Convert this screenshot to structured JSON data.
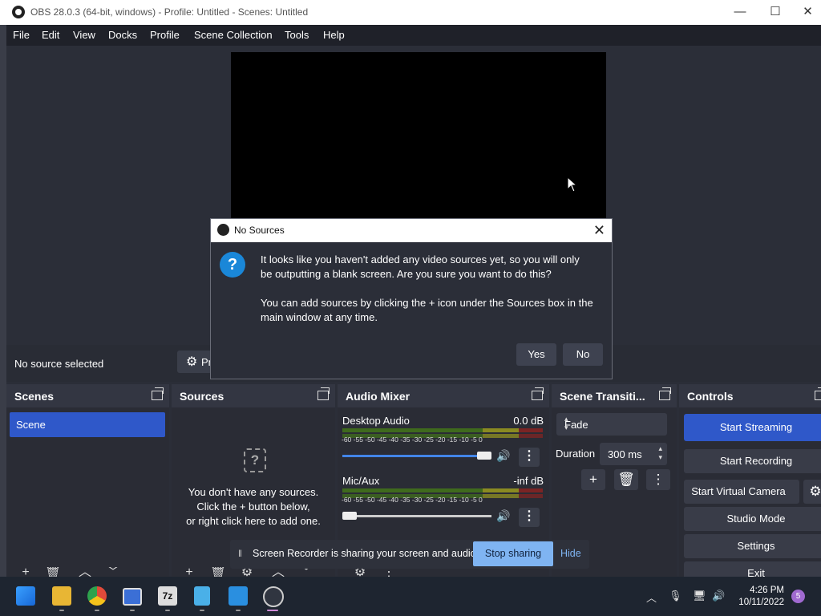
{
  "window": {
    "title": "OBS 28.0.3 (64-bit, windows) - Profile: Untitled - Scenes: Untitled",
    "minimize": "—",
    "maximize": "☐",
    "close": "✕"
  },
  "menu": [
    "File",
    "Edit",
    "View",
    "Docks",
    "Profile",
    "Scene Collection",
    "Tools",
    "Help"
  ],
  "source_bar": {
    "status": "No source selected",
    "properties_label": "Pr"
  },
  "docks": {
    "scenes": {
      "title": "Scenes",
      "items": [
        "Scene"
      ]
    },
    "sources": {
      "title": "Sources",
      "empty_line1": "You don't have any sources.",
      "empty_line2": "Click the + button below,",
      "empty_line3": "or right click here to add one."
    },
    "mixer": {
      "title": "Audio Mixer",
      "channels": [
        {
          "name": "Desktop Audio",
          "level": "0.0 dB",
          "volume_fraction": 1.0
        },
        {
          "name": "Mic/Aux",
          "level": "-inf dB",
          "volume_fraction": 0.0
        }
      ],
      "ticks": "-60 -55 -50 -45 -40 -35 -30 -25 -20 -15 -10 -5 0"
    },
    "transitions": {
      "title": "Scene Transiti...",
      "selected": "Fade",
      "duration_label": "Duration",
      "duration_value": "300 ms"
    },
    "controls": {
      "title": "Controls",
      "start_streaming": "Start Streaming",
      "start_recording": "Start Recording",
      "start_virtual_camera": "Start Virtual Camera",
      "studio_mode": "Studio Mode",
      "settings": "Settings",
      "exit": "Exit"
    }
  },
  "dialog": {
    "title": "No Sources",
    "line1": "It looks like you haven't added any video sources yet, so you will only",
    "line2": "be outputting a blank screen. Are you sure you want to do this?",
    "line3": "You can add sources by clicking the + icon under the Sources box in the",
    "line4": "main window at any time.",
    "yes": "Yes",
    "no": "No"
  },
  "recorder_bar": {
    "text": "Screen Recorder is sharing your screen and audio.",
    "stop": "Stop sharing",
    "hide": "Hide"
  },
  "taskbar": {
    "time": "4:26 PM",
    "date": "10/11/2022",
    "notifications": "5",
    "icons": [
      "start-icon",
      "file-explorer-icon",
      "chrome-icon",
      "camera-app-icon",
      "7zip-icon",
      "notepad-icon",
      "vscode-icon",
      "obs-icon"
    ]
  },
  "colors": {
    "accent": "#2f58c9",
    "dialog_icon": "#1a87d8",
    "stop_sharing": "#7fb4f2"
  }
}
